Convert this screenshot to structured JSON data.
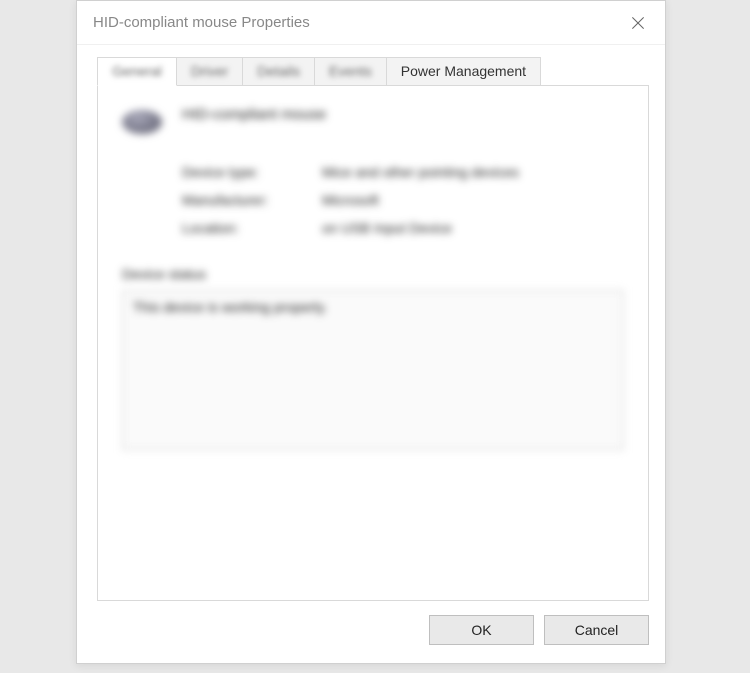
{
  "window": {
    "title": "HID-compliant mouse Properties"
  },
  "tabs": {
    "general": "General",
    "driver": "Driver",
    "details": "Details",
    "events": "Events",
    "power_management": "Power Management"
  },
  "general": {
    "device_name": "HID-compliant mouse",
    "rows": {
      "device_type_label": "Device type:",
      "device_type_value": "Mice and other pointing devices",
      "manufacturer_label": "Manufacturer:",
      "manufacturer_value": "Microsoft",
      "location_label": "Location:",
      "location_value": "on USB Input Device"
    },
    "status_label": "Device status",
    "status_text": "This device is working properly."
  },
  "buttons": {
    "ok": "OK",
    "cancel": "Cancel"
  }
}
